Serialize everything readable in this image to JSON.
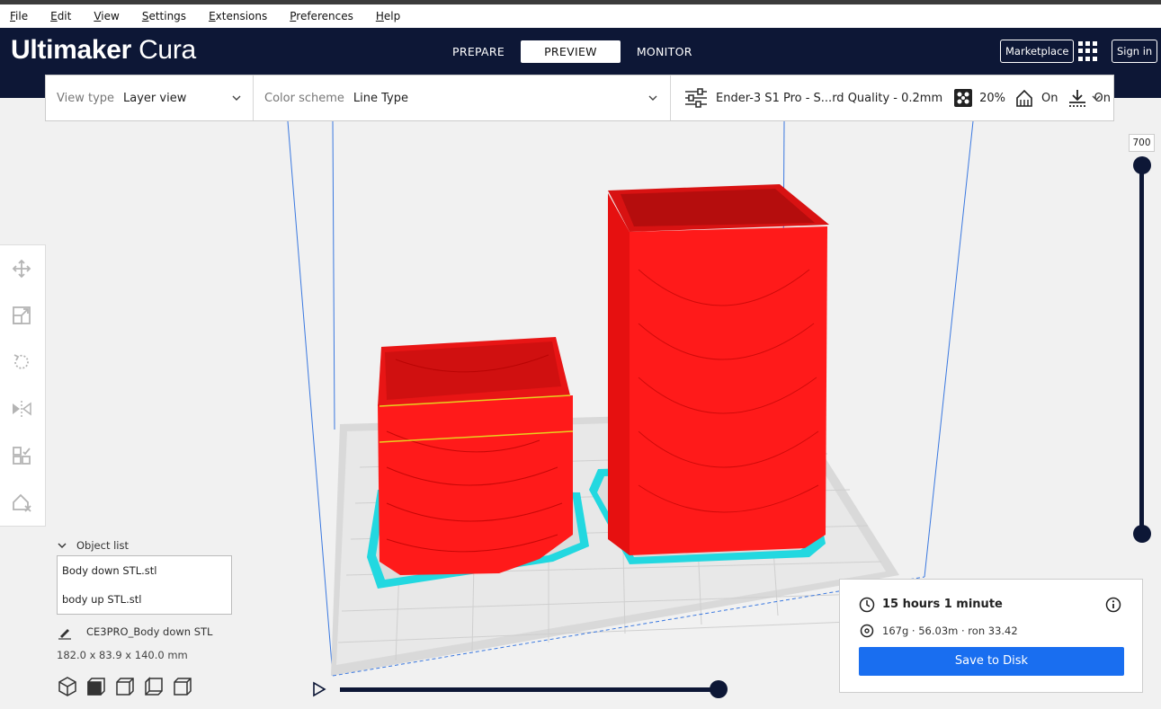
{
  "menu": [
    "File",
    "Edit",
    "View",
    "Settings",
    "Extensions",
    "Preferences",
    "Help"
  ],
  "app": {
    "brand_bold": "Ultimaker",
    "brand_light": " Cura"
  },
  "stages": {
    "prepare": "PREPARE",
    "preview": "PREVIEW",
    "monitor": "MONITOR"
  },
  "header": {
    "marketplace": "Marketplace",
    "signin": "Sign in"
  },
  "toolbar": {
    "view_type_label": "View type",
    "view_type_value": "Layer view",
    "color_scheme_label": "Color scheme",
    "color_scheme_value": "Line Type",
    "print_settings": "Ender-3 S1 Pro - S...rd Quality - 0.2mm",
    "infill": "20%",
    "support": "On",
    "adhesion": "On"
  },
  "layer_slider": {
    "current_layer": "700",
    "position": 1.0
  },
  "playback": {
    "progress": 1.0
  },
  "object_list": {
    "title": "Object list",
    "items": [
      "Body down STL.stl",
      "body up STL.stl"
    ],
    "selected_name": "CE3PRO_Body down STL",
    "dimensions": "182.0 x 83.9 x 140.0 mm"
  },
  "print_info": {
    "time": "15 hours 1 minute",
    "material": "167g · 56.03m · ron 33.42",
    "save_button": "Save to Disk"
  },
  "colors": {
    "header": "#0d1736",
    "accent": "#196ef0",
    "model": "#ff1a1a",
    "skirt": "#22d8e0"
  },
  "icons": [
    "move-icon",
    "scale-icon",
    "rotate-icon",
    "mirror-icon",
    "per-model-settings-icon",
    "support-blocker-icon",
    "clock-icon",
    "info-icon",
    "spool-icon",
    "pencil-icon",
    "play-icon"
  ]
}
